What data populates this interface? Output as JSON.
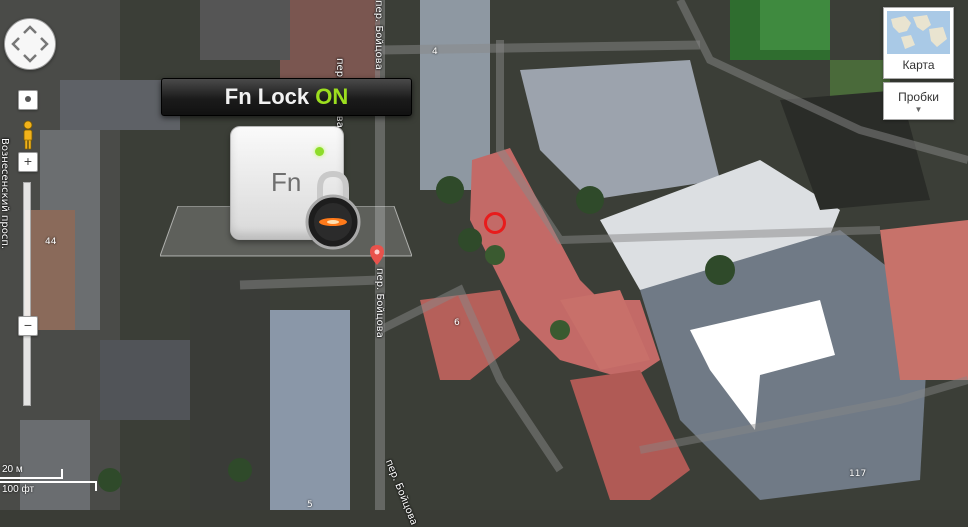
{
  "map": {
    "type": "satellite",
    "streets": [
      {
        "id": "bortsov-1",
        "label": "пер. Бойцова"
      },
      {
        "id": "bortsov-2",
        "label": "пер. Бойцова"
      },
      {
        "id": "bortsov-3",
        "label": "пер. Бойцова"
      },
      {
        "id": "bortsov-4",
        "label": "пер. Бойцова"
      },
      {
        "id": "voznesensky",
        "label": "Вознесенский просп."
      }
    ],
    "house_numbers": [
      "4",
      "6",
      "44",
      "117",
      "5"
    ]
  },
  "controls": {
    "pan_icon": "pan-arrows-icon",
    "zoom_in_label": "+",
    "zoom_out_label": "−",
    "street_view_icon": "pegman-icon",
    "map_type_label": "Карта",
    "traffic_label": "Пробки",
    "traffic_caret": "▼"
  },
  "overlay": {
    "fn_prefix": "Fn Lock ",
    "fn_state": "ON",
    "fn_key_label": "Fn",
    "lock_icon": "padlock-icon",
    "state_color": "#9cde1f"
  },
  "scale": {
    "metric": "20 м",
    "imperial": "100 фт"
  },
  "marker_color": "#e81c1c"
}
